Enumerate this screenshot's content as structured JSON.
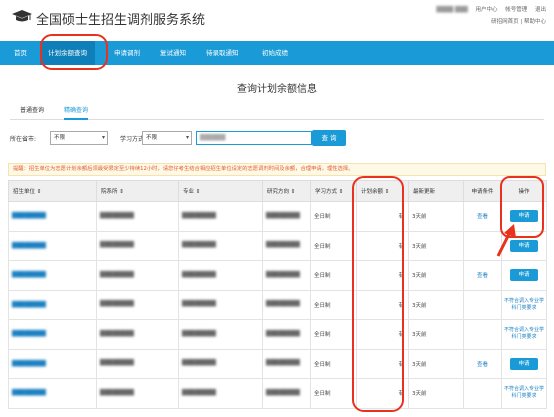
{
  "header": {
    "title": "全国硕士生招生调剂服务系统",
    "user": "████ ███",
    "links_top": [
      "用户中心",
      "帐号管理",
      "退出"
    ],
    "links_bottom": [
      "研招网首页",
      "帮助中心"
    ]
  },
  "nav": {
    "items": [
      {
        "label": "首页"
      },
      {
        "label": "计划余额查询"
      },
      {
        "label": "申请调剂"
      },
      {
        "label": "复试通知"
      },
      {
        "label": "待录取通知"
      },
      {
        "label": "初始成绩"
      }
    ]
  },
  "main": {
    "heading": "查询计划余额信息",
    "tabs": [
      "普通查询",
      "精确查询"
    ],
    "filters": {
      "location_label": "所在省市:",
      "location_value": "不限",
      "study_mode_label": "学习方式:",
      "study_mode_value": "不限",
      "keyword_value": "██████",
      "search_label": "查 询"
    },
    "notice": "提醒：招生单位为志愿计划余额后须最受限定至少持续12小时，请您仔考生结合相应招生单位设定的志愿调剂时间及余额，合理申请，理性选择。"
  },
  "table": {
    "headers": [
      "招生单位 ⇕",
      "院系所 ⇕",
      "专业 ⇕",
      "研究方向 ⇕",
      "学习方式 ⇕",
      "计划余额 ⇕",
      "最新更新",
      "申请条件",
      "操作"
    ],
    "rows": [
      {
        "unit": "████████",
        "dept": "████████",
        "major": "████████",
        "direction": "████████",
        "mode": "全日制",
        "balance": "有",
        "updated": "3天前",
        "cond": "查看",
        "action": "申请",
        "action_type": "button"
      },
      {
        "unit": "████████",
        "dept": "████████",
        "major": "████████",
        "direction": "████████",
        "mode": "全日制",
        "balance": "有",
        "updated": "3天前",
        "cond": "",
        "action": "申请",
        "action_type": "button"
      },
      {
        "unit": "████████",
        "dept": "████████",
        "major": "████████",
        "direction": "████████",
        "mode": "全日制",
        "balance": "有",
        "updated": "3天前",
        "cond": "查看",
        "action": "申请",
        "action_type": "button"
      },
      {
        "unit": "████████",
        "dept": "████████",
        "major": "████████",
        "direction": "████████",
        "mode": "全日制",
        "balance": "有",
        "updated": "3天前",
        "cond": "",
        "action": "不符合调入专业学科门类要求",
        "action_type": "text"
      },
      {
        "unit": "████████",
        "dept": "████████",
        "major": "████████",
        "direction": "████████",
        "mode": "全日制",
        "balance": "有",
        "updated": "3天前",
        "cond": "",
        "action": "不符合调入专业学科门类要求",
        "action_type": "text"
      },
      {
        "unit": "████████",
        "dept": "████████",
        "major": "████████",
        "direction": "████████",
        "mode": "全日制",
        "balance": "有",
        "updated": "3天前",
        "cond": "查看",
        "action": "申请",
        "action_type": "button"
      },
      {
        "unit": "████████",
        "dept": "████████",
        "major": "████████",
        "direction": "████████",
        "mode": "全日制",
        "balance": "有",
        "updated": "3天前",
        "cond": "",
        "action": "不符合调入专业学科门类要求",
        "action_type": "text"
      }
    ]
  },
  "colors": {
    "primary": "#1a9ad6",
    "annotation": "#e8321e",
    "notice_text": "#e25c2e"
  }
}
